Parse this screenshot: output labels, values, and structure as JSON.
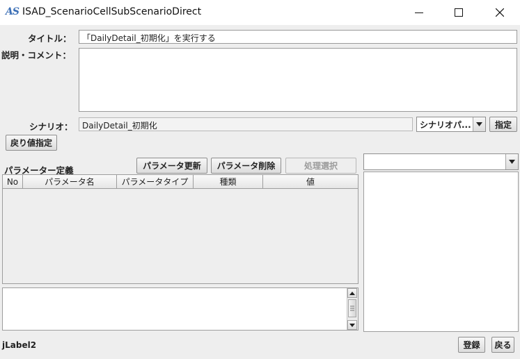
{
  "window": {
    "app_icon": "AS",
    "title": "ISAD_ScenarioCellSubScenarioDirect"
  },
  "form": {
    "title_label": "タイトル：",
    "title_value": "「DailyDetail_初期化」を実行する",
    "comment_label": "説明・コメント：",
    "comment_value": "",
    "scenario_label": "シナリオ：",
    "scenario_value": "DailyDetail_初期化",
    "scenario_combo": "シナリオパ...",
    "specify_button": "指定",
    "return_value_button": "戻り値指定"
  },
  "params": {
    "section_title": "パラメーター定義",
    "update_button": "パラメータ更新",
    "delete_button": "パラメータ削除",
    "process_select_button": "処理選択",
    "columns": [
      "No",
      "パラメータ名",
      "パラメータタイプ",
      "種類",
      "値"
    ],
    "rows": []
  },
  "right_panel": {
    "combo_value": ""
  },
  "footer": {
    "status_label": "jLabel2",
    "register_button": "登録",
    "back_button": "戻る"
  },
  "icons": {
    "minimize": "minimize-icon",
    "maximize": "maximize-icon",
    "close": "close-icon",
    "dropdown": "chevron-down-icon"
  }
}
